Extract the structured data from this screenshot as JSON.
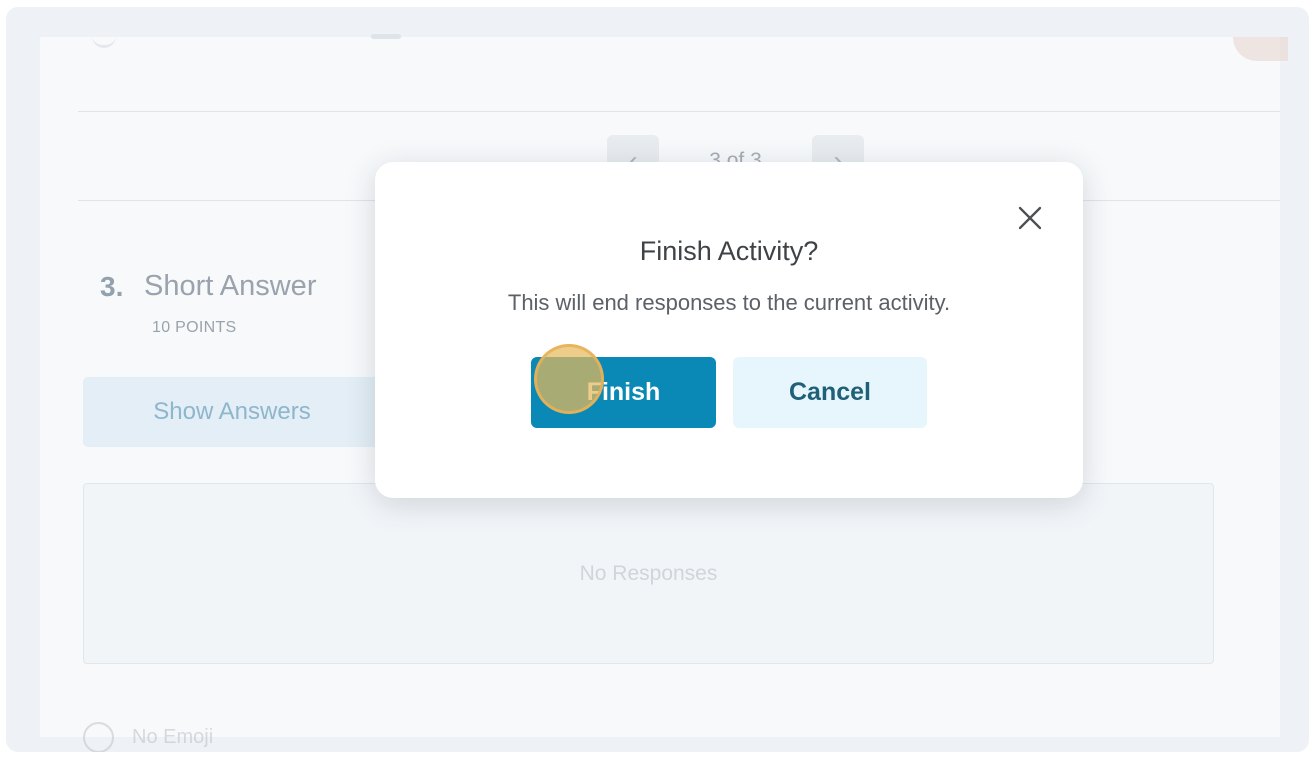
{
  "pagination": {
    "label": "3 of 3",
    "previous_icon": "‹",
    "next_icon": "›"
  },
  "question": {
    "number": "3.",
    "title": "Short Answer",
    "points": "10 POINTS"
  },
  "show_answers_label": "Show Answers",
  "responses": {
    "empty_text": "No Responses"
  },
  "bottom_row_text": "No Emoji",
  "modal": {
    "title": "Finish Activity?",
    "message": "This will end responses to the current activity.",
    "finish_label": "Finish",
    "cancel_label": "Cancel",
    "close_icon": "close-icon"
  },
  "colors": {
    "primary": "#0A88B6",
    "secondary": "#E6F6FC",
    "secondary_text": "#1F5F78",
    "click_indicator": "#E8B85B"
  }
}
